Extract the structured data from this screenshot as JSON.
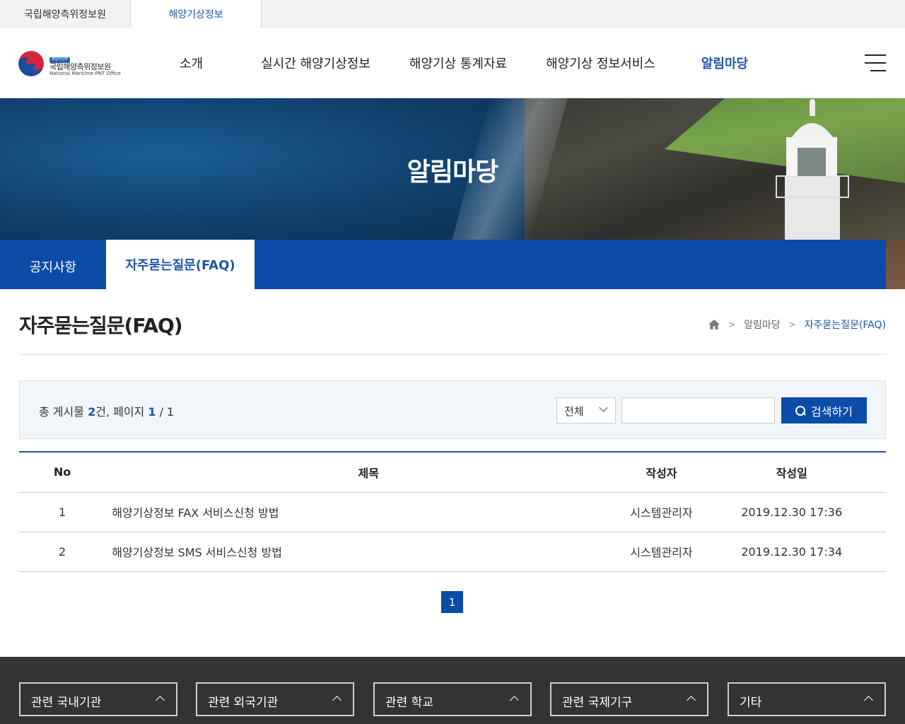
{
  "site_tabs": [
    "국립해양측위정보원",
    "해양기상정보"
  ],
  "logo": {
    "badge": "해양수산부",
    "kor": "국립해양측위정보원",
    "eng": "National Maritime PNT Office"
  },
  "gnb": [
    "소개",
    "실시간 해양기상정보",
    "해양기상 통계자료",
    "해양기상 정보서비스",
    "알림마당"
  ],
  "hero_title": "알림마당",
  "subtabs": [
    "공지사항",
    "자주묻는질문(FAQ)"
  ],
  "page_title": "자주묻는질문(FAQ)",
  "breadcrumb": [
    "알림마당",
    "자주묻는질문(FAQ)"
  ],
  "search": {
    "count_prefix": "총 게시물 ",
    "count": "2",
    "count_mid": "건, 페이지 ",
    "page": "1",
    "page_total": " / 1",
    "select_value": "전체",
    "keyword": "",
    "button": "검색하기"
  },
  "table": {
    "headers": [
      "No",
      "제목",
      "작성자",
      "작성일"
    ],
    "rows": [
      {
        "no": "1",
        "title": "해양기상정보 FAX 서비스신청 방법",
        "writer": "시스템관리자",
        "date": "2019.12.30 17:36"
      },
      {
        "no": "2",
        "title": "해양기상정보 SMS 서비스신청 방법",
        "writer": "시스템관리자",
        "date": "2019.12.30 17:34"
      }
    ]
  },
  "pagination": {
    "current": "1"
  },
  "footer_links": [
    "관련 국내기관",
    "관련 외국기관",
    "관련 학교",
    "관련 국제기구",
    "기타"
  ],
  "colors": {
    "primary": "#0a4ca8",
    "accent_text": "#1f55a8",
    "footer": "#333333"
  }
}
